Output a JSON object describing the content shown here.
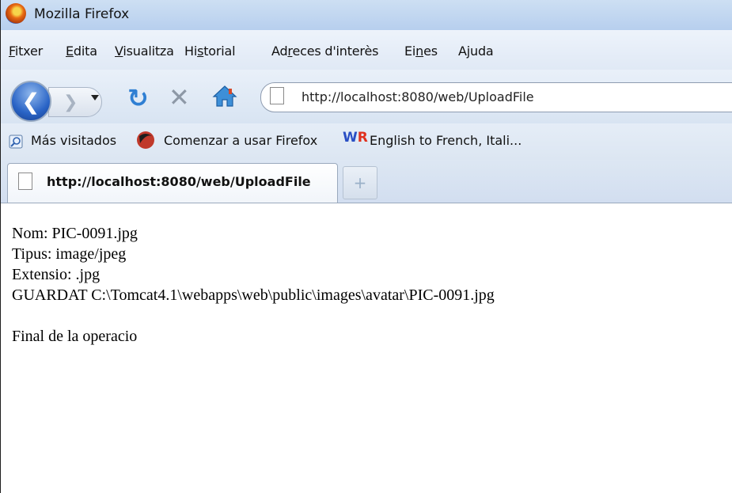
{
  "window": {
    "title": "Mozilla Firefox"
  },
  "menu": [
    {
      "label": "Fitxer",
      "accesskey_index": 0
    },
    {
      "label": "Edita",
      "accesskey_index": 0
    },
    {
      "label": "Visualitza",
      "accesskey_index": 0
    },
    {
      "label": "Historial",
      "accesskey_index": 2
    },
    {
      "label": "Adreces d'interès",
      "accesskey_index": 2
    },
    {
      "label": "Eines",
      "accesskey_index": 2
    },
    {
      "label": "Ajuda",
      "accesskey_index": 1
    }
  ],
  "nav": {
    "back_icon": "back-arrow-icon",
    "forward_icon": "forward-arrow-icon",
    "reload_icon": "reload-icon",
    "stop_icon": "stop-icon",
    "home_icon": "home-icon",
    "url": "http://localhost:8080/web/UploadFile"
  },
  "bookmarks": [
    {
      "label": "Más visitados",
      "icon": "search-icon"
    },
    {
      "label": "Comenzar a usar Firefox",
      "icon": "firefox-icon"
    },
    {
      "label": "English to French, Itali...",
      "icon": "wordreference-icon"
    }
  ],
  "tabs": [
    {
      "label": "http://localhost:8080/web/UploadFile",
      "active": true
    }
  ],
  "newtab_symbol": "+",
  "content": {
    "lines": [
      "Nom: PIC-0091.jpg",
      "Tipus: image/jpeg",
      "Extensio: .jpg",
      "GUARDAT C:\\Tomcat4.1\\webapps\\web\\public\\images\\avatar\\PIC-0091.jpg"
    ],
    "final": "Final de la operacio"
  },
  "colors": {
    "titlebar": "#cddff3",
    "accent_blue": "#2a64c6",
    "reload_blue": "#2f7fd3"
  }
}
